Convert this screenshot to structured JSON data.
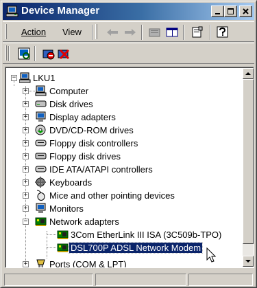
{
  "window": {
    "title": "Device Manager"
  },
  "menu": {
    "action": "Action",
    "view": "View"
  },
  "tree": {
    "root": "LKU1",
    "categories": [
      "Computer",
      "Disk drives",
      "Display adapters",
      "DVD/CD-ROM drives",
      "Floppy disk controllers",
      "Floppy disk drives",
      "IDE ATA/ATAPI controllers",
      "Keyboards",
      "Mice and other pointing devices",
      "Monitors",
      "Network adapters"
    ],
    "network_children": [
      "3Com EtherLink III ISA (3C509b-TPO)",
      "DSL700P ADSL Network Modem"
    ],
    "last": "Ports (COM & LPT)",
    "selected": "DSL700P ADSL Network Modem"
  },
  "colors": {
    "title_start": "#0a246a",
    "title_end": "#a6caf0",
    "selection": "#0a246a",
    "chrome": "#d4d0c8"
  }
}
